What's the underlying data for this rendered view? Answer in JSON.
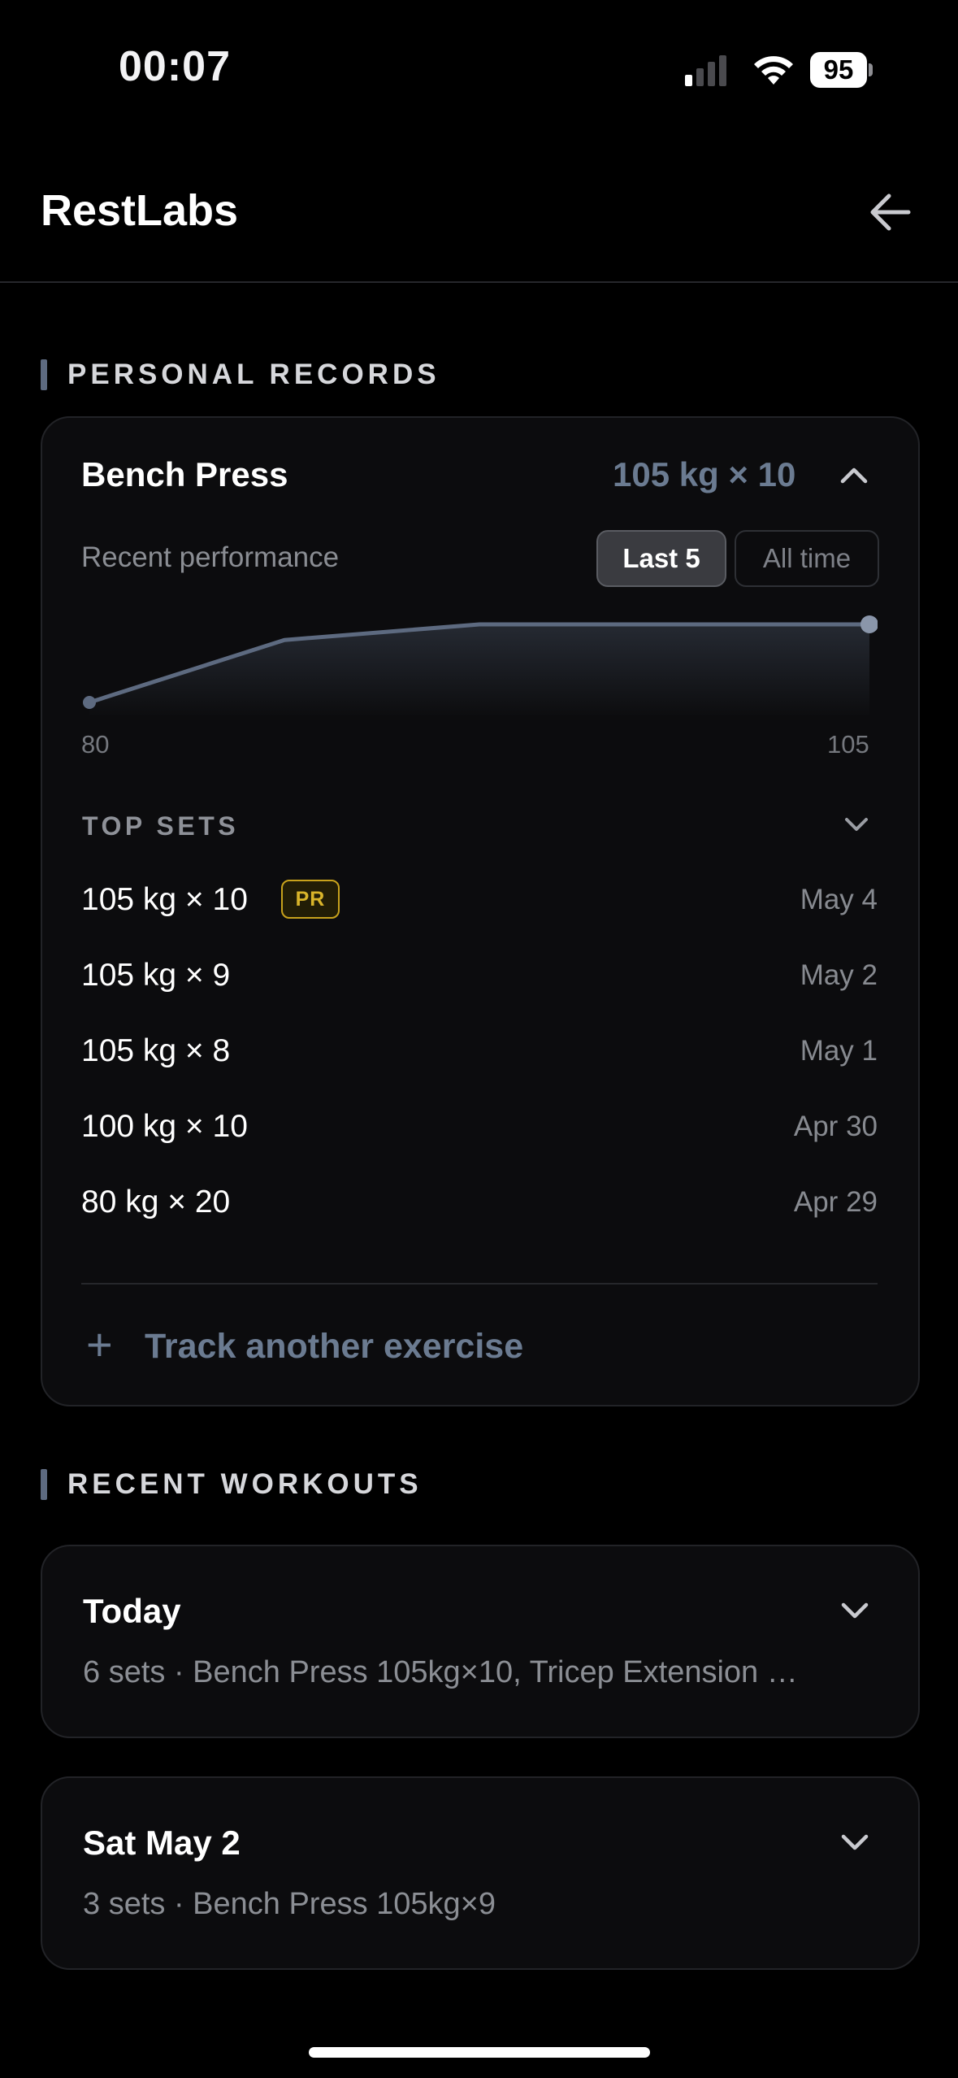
{
  "status_bar": {
    "time": "00:07",
    "battery": "95"
  },
  "header": {
    "title": "RestLabs"
  },
  "personal_records": {
    "section_title": "PERSONAL RECORDS",
    "exercise": {
      "name": "Bench Press",
      "best": "105 kg × 10",
      "recent_label": "Recent performance",
      "range_options": [
        "Last 5",
        "All time"
      ],
      "selected_range": "Last 5"
    },
    "chart_data": {
      "type": "area",
      "x": [
        1,
        2,
        3,
        4,
        5
      ],
      "values": [
        80,
        100,
        105,
        105,
        105
      ],
      "tick_labels": {
        "min": "80",
        "max": "105"
      },
      "ylim": [
        80,
        105
      ],
      "line_color": "#5d6a80",
      "grid": false
    },
    "top_sets": {
      "label": "TOP SETS",
      "rows": [
        {
          "value": "105 kg × 10",
          "badge": "PR",
          "date": "May 4"
        },
        {
          "value": "105 kg × 9",
          "badge": "",
          "date": "May 2"
        },
        {
          "value": "105 kg × 8",
          "badge": "",
          "date": "May 1"
        },
        {
          "value": "100 kg × 10",
          "badge": "",
          "date": "Apr 30"
        },
        {
          "value": "80 kg × 20",
          "badge": "",
          "date": "Apr 29"
        }
      ]
    },
    "track_another": "Track another exercise"
  },
  "recent_workouts": {
    "section_title": "RECENT WORKOUTS",
    "items": [
      {
        "title": "Today",
        "summary": "6 sets · Bench Press 105kg×10, Tricep Extension …"
      },
      {
        "title": "Sat May 2",
        "summary": "3 sets · Bench Press 105kg×9"
      }
    ]
  },
  "colors": {
    "accent": "#6b7b91",
    "pr_badge": "#d9b42a",
    "background": "#000000",
    "card": "#0c0c0e"
  }
}
